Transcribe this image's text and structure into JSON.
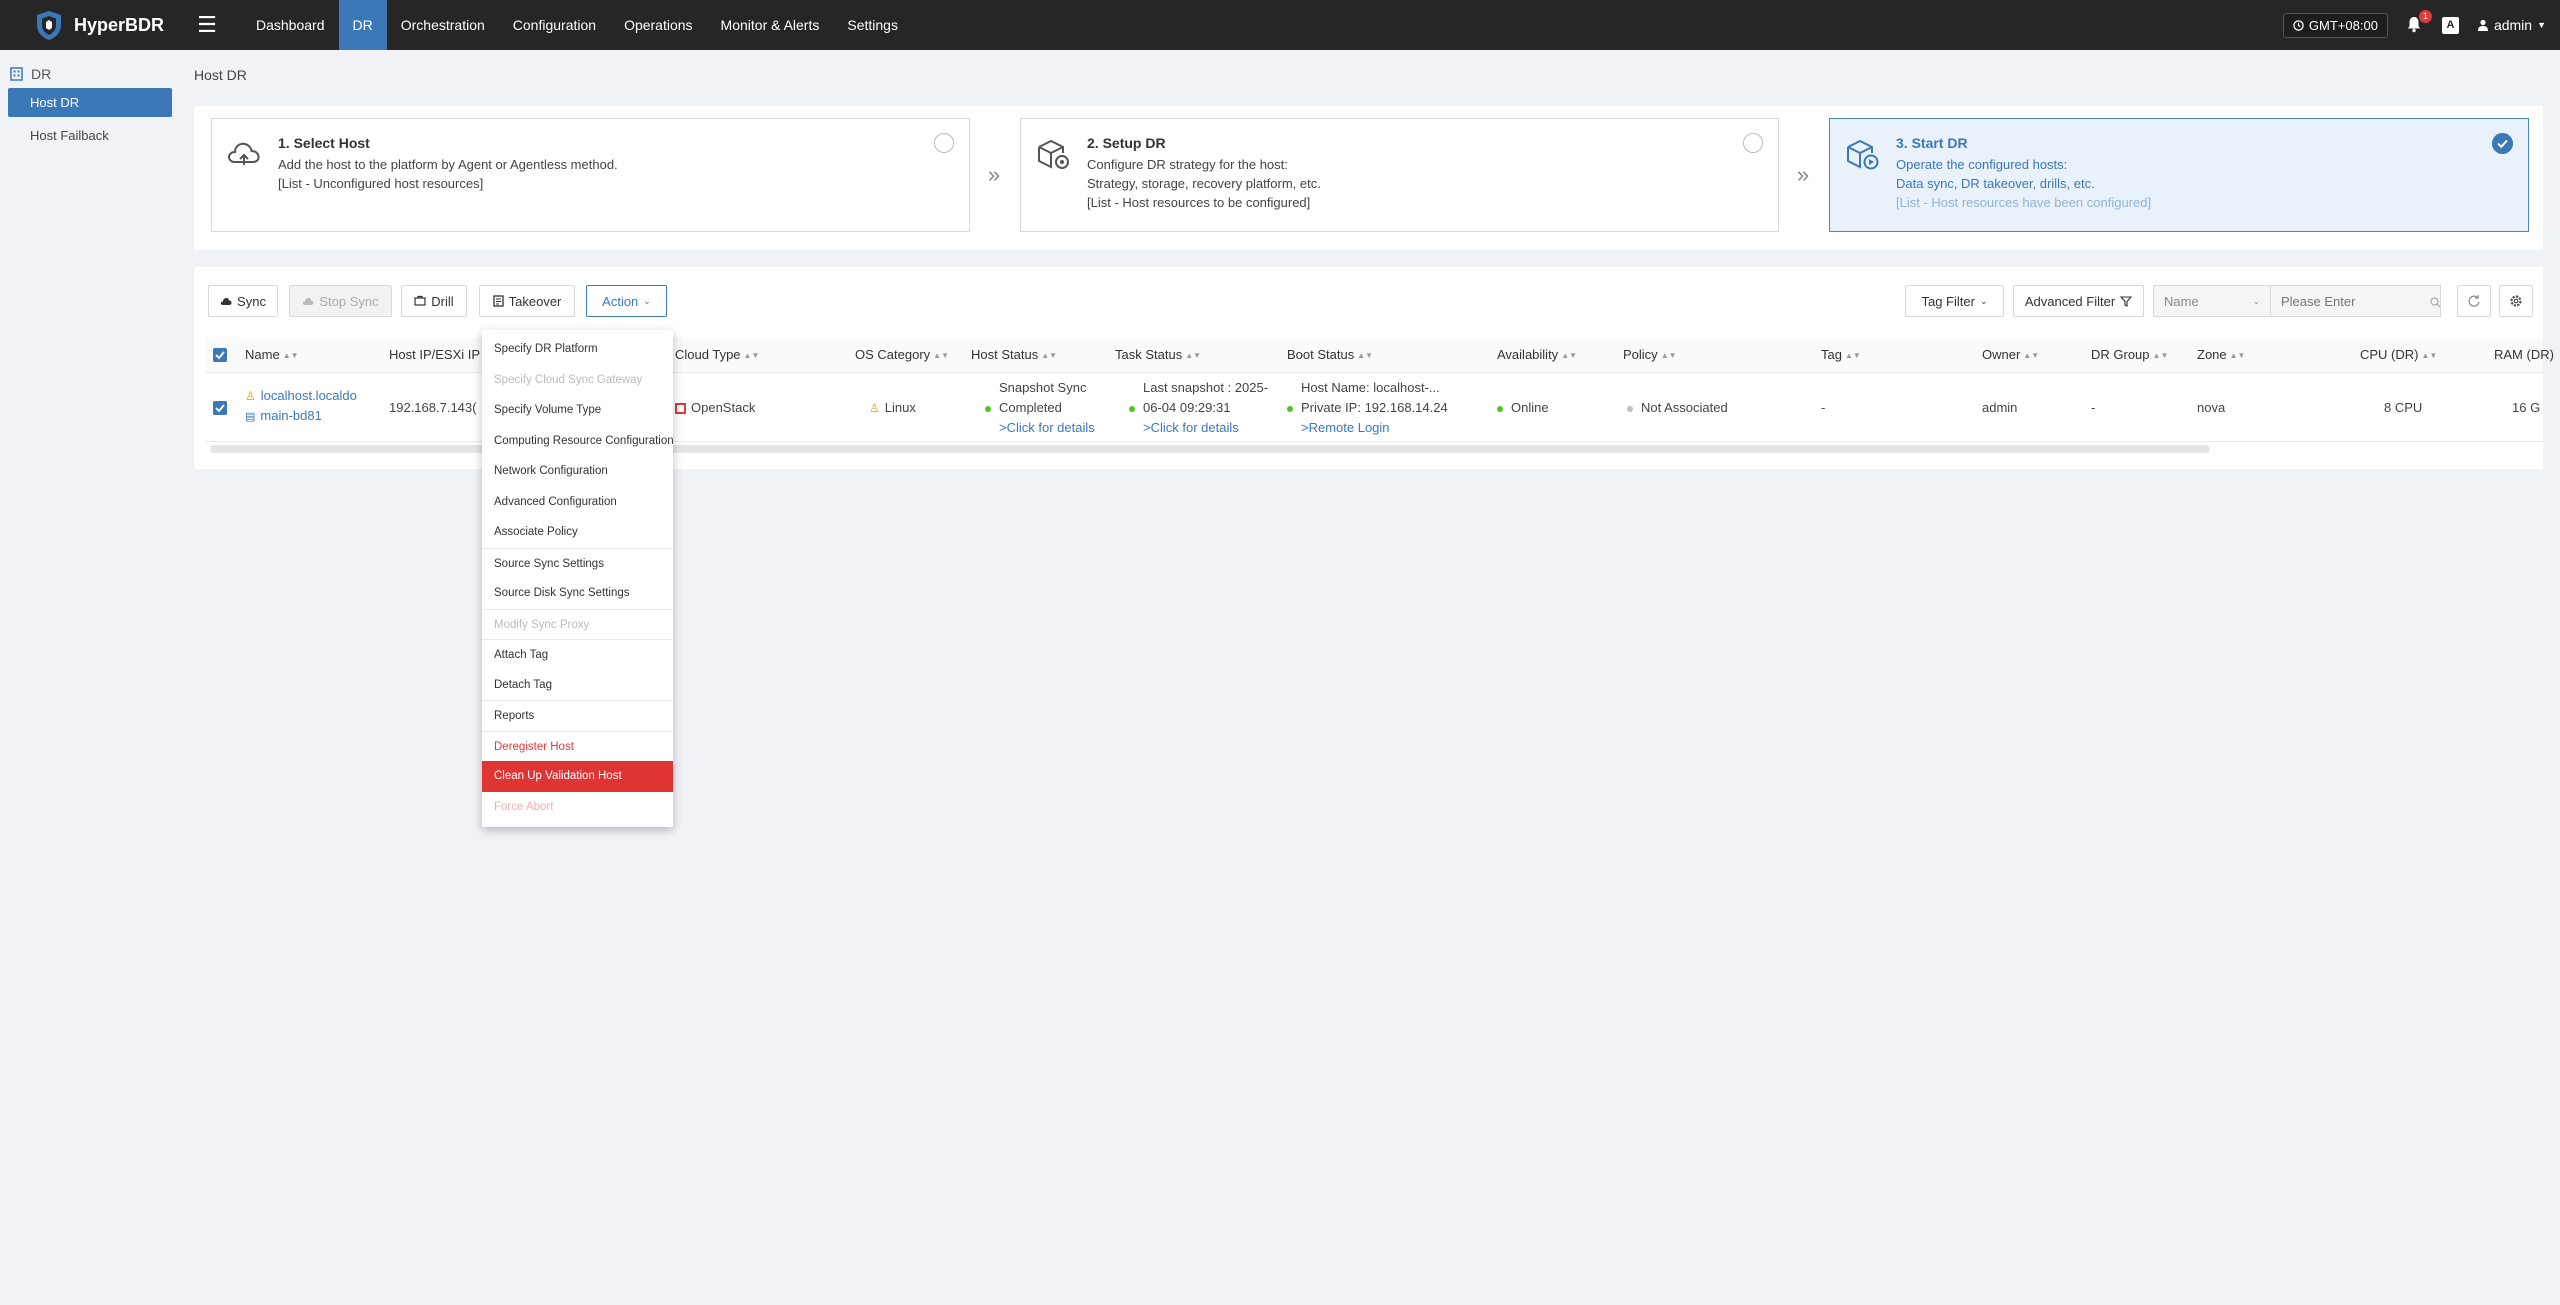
{
  "app": {
    "name": "HyperBDR"
  },
  "nav": [
    {
      "label": "Dashboard",
      "active": false
    },
    {
      "label": "DR",
      "active": true
    },
    {
      "label": "Orchestration",
      "active": false
    },
    {
      "label": "Configuration",
      "active": false
    },
    {
      "label": "Operations",
      "active": false
    },
    {
      "label": "Monitor & Alerts",
      "active": false
    },
    {
      "label": "Settings",
      "active": false
    }
  ],
  "topright": {
    "timezone": "GMT+08:00",
    "notifications": "1",
    "lang": "A",
    "user": "admin"
  },
  "sidebar": {
    "section": "DR",
    "items": [
      {
        "label": "Host DR",
        "active": true
      },
      {
        "label": "Host Failback",
        "active": false
      }
    ]
  },
  "breadcrumb": "Host DR",
  "steps": [
    {
      "title": "1. Select Host",
      "lines": [
        "Add the host to the platform by Agent or Agentless method.",
        "[List - Unconfigured host resources]"
      ]
    },
    {
      "title": "2. Setup DR",
      "lines": [
        "Configure DR strategy for the host:",
        "Strategy, storage, recovery platform, etc.",
        "[List - Host resources to be configured]"
      ]
    },
    {
      "title": "3. Start DR",
      "lines": [
        "Operate the configured hosts:",
        "Data sync, DR takeover, drills, etc.",
        "[List - Host resources have been configured]"
      ]
    }
  ],
  "toolbar": {
    "sync": "Sync",
    "stop_sync": "Stop Sync",
    "drill": "Drill",
    "takeover": "Takeover",
    "action": "Action",
    "tag_filter": "Tag Filter",
    "advanced_filter": "Advanced Filter",
    "search_field": "Name",
    "search_placeholder": "Please Enter"
  },
  "table": {
    "columns": [
      "Name",
      "Host IP/ESXi IP",
      "Cloud Type",
      "OS Category",
      "Host Status",
      "Task Status",
      "Boot Status",
      "Availability",
      "Policy",
      "Tag",
      "Owner",
      "DR Group",
      "Zone",
      "CPU (DR)",
      "RAM (DR)"
    ],
    "rows": [
      {
        "name_line1": "localhost.localdo",
        "name_line2": "main-bd81",
        "host_ip": "192.168.7.143(",
        "cloud_type": "OpenStack",
        "os_category": "Linux",
        "host_status_1": "Snapshot Sync",
        "host_status_2": "Completed",
        "host_status_link": ">Click for details",
        "task_status_1": "Last snapshot : 2025-",
        "task_status_2": "06-04 09:29:31",
        "task_status_link": ">Click for details",
        "boot_status_1": "Host Name: localhost-...",
        "boot_status_2": "Private IP: 192.168.14.24",
        "boot_status_link": ">Remote Login",
        "availability": "Online",
        "policy": "Not Associated",
        "tag": "-",
        "owner": "admin",
        "dr_group": "-",
        "zone": "nova",
        "cpu": "8 CPU",
        "ram": "16 G"
      }
    ]
  },
  "action_menu": [
    {
      "label": "Specify DR Platform",
      "state": "normal"
    },
    {
      "label": "Specify Cloud Sync Gateway",
      "state": "disabled"
    },
    {
      "label": "Specify Volume Type",
      "state": "normal"
    },
    {
      "label": "Computing Resource Configuration",
      "state": "normal"
    },
    {
      "label": "Network Configuration",
      "state": "normal"
    },
    {
      "label": "Advanced Configuration",
      "state": "normal"
    },
    {
      "label": "Associate Policy",
      "state": "normal"
    },
    {
      "label": "Source Sync Settings",
      "state": "normal"
    },
    {
      "label": "Source Disk Sync Settings",
      "state": "normal"
    },
    {
      "label": "Modify Sync Proxy",
      "state": "disabled"
    },
    {
      "label": "Attach Tag",
      "state": "normal"
    },
    {
      "label": "Detach Tag",
      "state": "normal"
    },
    {
      "label": "Reports",
      "state": "normal"
    },
    {
      "label": "Deregister Host",
      "state": "danger"
    },
    {
      "label": "Clean Up Validation Host",
      "state": "danger-active"
    },
    {
      "label": "Force Abort",
      "state": "faint"
    }
  ],
  "colors": {
    "topbar": "#262626",
    "accent": "#3b78b8",
    "danger": "#df3434",
    "online": "#52c41a"
  }
}
